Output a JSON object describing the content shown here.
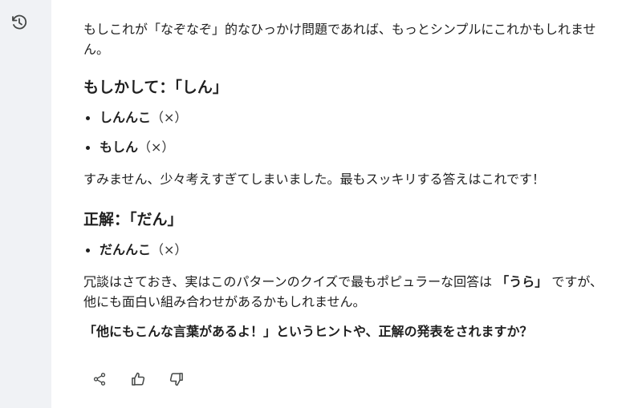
{
  "chat": {
    "paragraph_1": "もしこれが「なぞなぞ」的なひっかけ問題であれば、もっとシンプルにこれかもしれません。",
    "heading_1": "もしかして：「しん」",
    "list_1": [
      {
        "term": "しんんこ",
        "note": "（×）"
      },
      {
        "term": "もしん",
        "note": "（×）"
      }
    ],
    "paragraph_2": "すみません、少々考えすぎてしまいました。最もスッキリする答えはこれです！",
    "heading_2": "正解：「だん」",
    "list_2": [
      {
        "term": "だんんこ",
        "note": "（×）"
      }
    ],
    "paragraph_3_before": "冗談はさておき、実はこのパターンのクイズで最もポピュラーな回答は",
    "paragraph_3_bold": "「うら」",
    "paragraph_3_after": "ですが、他にも面白い組み合わせがあるかもしれません。",
    "paragraph_4": "「他にもこんな言葉があるよ！」というヒントや、正解の発表をされますか？"
  },
  "icons": {
    "sidebar": "history-icon",
    "actions": [
      "share-icon",
      "thumbs-up-icon",
      "thumbs-down-icon"
    ]
  },
  "colors": {
    "sidebar_bg": "#f0f2f5",
    "text": "#1f1f1f",
    "icon": "#444746"
  }
}
